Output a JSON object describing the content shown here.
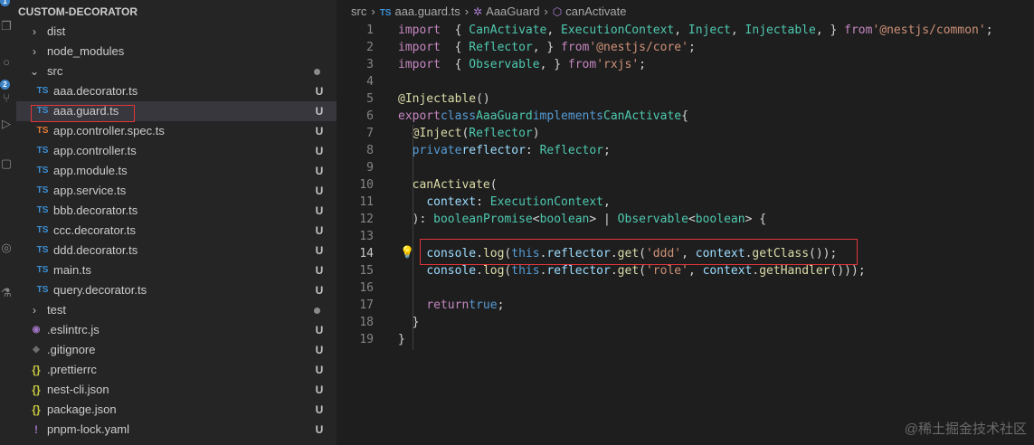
{
  "activity_bar": {
    "icons": [
      "files-icon",
      "search-icon",
      "source-control-icon",
      "run-debug-icon",
      "extensions-icon",
      "remote-icon",
      "testing-icon"
    ],
    "badges": [
      "1",
      "2"
    ]
  },
  "explorer": {
    "title": "CUSTOM-DECORATOR",
    "items": [
      {
        "name": "dist",
        "type": "folder",
        "chevron": "›",
        "status": ""
      },
      {
        "name": "node_modules",
        "type": "folder",
        "chevron": "›",
        "status": ""
      },
      {
        "name": "src",
        "type": "folder",
        "chevron": "⌄",
        "status": "dot"
      },
      {
        "name": "aaa.decorator.ts",
        "type": "ts",
        "status": "U"
      },
      {
        "name": "aaa.guard.ts",
        "type": "ts",
        "status": "U",
        "selected": true
      },
      {
        "name": "app.controller.spec.ts",
        "type": "ts-spec",
        "status": "U"
      },
      {
        "name": "app.controller.ts",
        "type": "ts",
        "status": "U"
      },
      {
        "name": "app.module.ts",
        "type": "ts",
        "status": "U"
      },
      {
        "name": "app.service.ts",
        "type": "ts",
        "status": "U"
      },
      {
        "name": "bbb.decorator.ts",
        "type": "ts",
        "status": "U"
      },
      {
        "name": "ccc.decorator.ts",
        "type": "ts",
        "status": "U"
      },
      {
        "name": "ddd.decorator.ts",
        "type": "ts",
        "status": "U"
      },
      {
        "name": "main.ts",
        "type": "ts",
        "status": "U"
      },
      {
        "name": "query.decorator.ts",
        "type": "ts",
        "status": "U"
      },
      {
        "name": "test",
        "type": "folder",
        "chevron": "›",
        "status": "dot"
      },
      {
        "name": ".eslintrc.js",
        "type": "eslint",
        "status": "U"
      },
      {
        "name": ".gitignore",
        "type": "git",
        "status": "U"
      },
      {
        "name": ".prettierrc",
        "type": "json",
        "status": "U"
      },
      {
        "name": "nest-cli.json",
        "type": "json",
        "status": "U"
      },
      {
        "name": "package.json",
        "type": "json",
        "status": "U"
      },
      {
        "name": "pnpm-lock.yaml",
        "type": "yaml",
        "status": "U"
      }
    ],
    "icon_glyphs": {
      "ts": "TS",
      "ts-spec": "TS",
      "eslint": "◉",
      "git": "◆",
      "json": "{}",
      "yaml": "!"
    },
    "icon_colors": {
      "ts": "#3b8fd6",
      "ts-spec": "#e37933",
      "eslint": "#a074c4",
      "git": "#6d6d6d",
      "json": "#cbcb41",
      "yaml": "#a074c4"
    }
  },
  "breadcrumb": {
    "folder": "src",
    "ts_badge": "TS",
    "file": "aaa.guard.ts",
    "class": "AaaGuard",
    "method": "canActivate"
  },
  "editor": {
    "active_line": 14,
    "lines": [
      {
        "n": "1",
        "t": [
          [
            "kw2",
            "import"
          ],
          [
            "",
            "  { "
          ],
          [
            "cls",
            "CanActivate"
          ],
          [
            "",
            ", "
          ],
          [
            "cls",
            "ExecutionContext"
          ],
          [
            "",
            ", "
          ],
          [
            "cls",
            "Inject"
          ],
          [
            "",
            ", "
          ],
          [
            "cls",
            "Injectable"
          ],
          [
            "",
            ", } "
          ],
          [
            "kw2",
            "from"
          ],
          [
            "",
            ""
          ],
          [
            "str",
            "'@nestjs/common'"
          ],
          [
            "",
            ";"
          ]
        ]
      },
      {
        "n": "2",
        "t": [
          [
            "kw2",
            "import"
          ],
          [
            "",
            "  { "
          ],
          [
            "cls",
            "Reflector"
          ],
          [
            "",
            ", } "
          ],
          [
            "kw2",
            "from"
          ],
          [
            "",
            ""
          ],
          [
            "str",
            "'@nestjs/core'"
          ],
          [
            "",
            ";"
          ]
        ]
      },
      {
        "n": "3",
        "t": [
          [
            "kw2",
            "import"
          ],
          [
            "",
            "  { "
          ],
          [
            "cls",
            "Observable"
          ],
          [
            "",
            ", } "
          ],
          [
            "kw2",
            "from"
          ],
          [
            "",
            ""
          ],
          [
            "str",
            "'rxjs'"
          ],
          [
            "",
            ";"
          ]
        ]
      },
      {
        "n": "4",
        "t": []
      },
      {
        "n": "5",
        "t": [
          [
            "dec",
            "@Injectable"
          ],
          [
            "",
            "()"
          ]
        ]
      },
      {
        "n": "6",
        "t": [
          [
            "kw2",
            "export"
          ],
          [
            "",
            ""
          ],
          [
            "kw",
            "class"
          ],
          [
            "",
            ""
          ],
          [
            "cls",
            "AaaGuard"
          ],
          [
            "",
            ""
          ],
          [
            "kw",
            "implements"
          ],
          [
            "",
            ""
          ],
          [
            "cls",
            "CanActivate"
          ],
          [
            "",
            "{"
          ]
        ]
      },
      {
        "n": "7",
        "t": [
          [
            "",
            "  "
          ],
          [
            "dec",
            "@Inject"
          ],
          [
            "",
            "("
          ],
          [
            "cls",
            "Reflector"
          ],
          [
            "",
            ")"
          ]
        ]
      },
      {
        "n": "8",
        "t": [
          [
            "",
            "  "
          ],
          [
            "kw",
            "private"
          ],
          [
            "",
            ""
          ],
          [
            "var",
            "reflector"
          ],
          [
            "",
            ": "
          ],
          [
            "cls",
            "Reflector"
          ],
          [
            "",
            ";"
          ]
        ]
      },
      {
        "n": "9",
        "t": []
      },
      {
        "n": "10",
        "t": [
          [
            "",
            "  "
          ],
          [
            "fn",
            "canActivate"
          ],
          [
            "",
            "("
          ]
        ]
      },
      {
        "n": "11",
        "t": [
          [
            "",
            "    "
          ],
          [
            "var",
            "context"
          ],
          [
            "",
            ": "
          ],
          [
            "cls",
            "ExecutionContext"
          ],
          [
            "",
            ","
          ]
        ]
      },
      {
        "n": "12",
        "t": [
          [
            "",
            "  ): "
          ],
          [
            "cls",
            "boolean"
          ],
          [
            "",
            ""
          ],
          [
            "cls",
            "Promise"
          ],
          [
            "",
            "<"
          ],
          [
            "cls",
            "boolean"
          ],
          [
            "",
            "> | "
          ],
          [
            "cls",
            "Observable"
          ],
          [
            "",
            "<"
          ],
          [
            "cls",
            "boolean"
          ],
          [
            "",
            "> {"
          ]
        ]
      },
      {
        "n": "13",
        "t": []
      },
      {
        "n": "14",
        "t": [
          [
            "",
            "    "
          ],
          [
            "var",
            "console"
          ],
          [
            "",
            "."
          ],
          [
            "fn",
            "log"
          ],
          [
            "",
            "("
          ],
          [
            "kw",
            "this"
          ],
          [
            "",
            "."
          ],
          [
            "var",
            "reflector"
          ],
          [
            "",
            "."
          ],
          [
            "fn",
            "get"
          ],
          [
            "",
            "("
          ],
          [
            "str",
            "'ddd'"
          ],
          [
            "",
            ", "
          ],
          [
            "var",
            "context"
          ],
          [
            "",
            "."
          ],
          [
            "fn",
            "getClass"
          ],
          [
            "",
            "());"
          ]
        ]
      },
      {
        "n": "15",
        "t": [
          [
            "",
            "    "
          ],
          [
            "var",
            "console"
          ],
          [
            "",
            "."
          ],
          [
            "fn",
            "log"
          ],
          [
            "",
            "("
          ],
          [
            "kw",
            "this"
          ],
          [
            "",
            "."
          ],
          [
            "var",
            "reflector"
          ],
          [
            "",
            "."
          ],
          [
            "fn",
            "get"
          ],
          [
            "",
            "("
          ],
          [
            "str",
            "'role'"
          ],
          [
            "",
            ", "
          ],
          [
            "var",
            "context"
          ],
          [
            "",
            "."
          ],
          [
            "fn",
            "getHandler"
          ],
          [
            "",
            "()));"
          ]
        ]
      },
      {
        "n": "16",
        "t": []
      },
      {
        "n": "17",
        "t": [
          [
            "",
            "    "
          ],
          [
            "kw2",
            "return"
          ],
          [
            "",
            ""
          ],
          [
            "kw",
            "true"
          ],
          [
            "",
            ";"
          ]
        ]
      },
      {
        "n": "18",
        "t": [
          [
            "",
            "  }"
          ]
        ]
      },
      {
        "n": "19",
        "t": [
          [
            "",
            "}"
          ]
        ]
      }
    ]
  },
  "watermark": "@稀土掘金技术社区"
}
